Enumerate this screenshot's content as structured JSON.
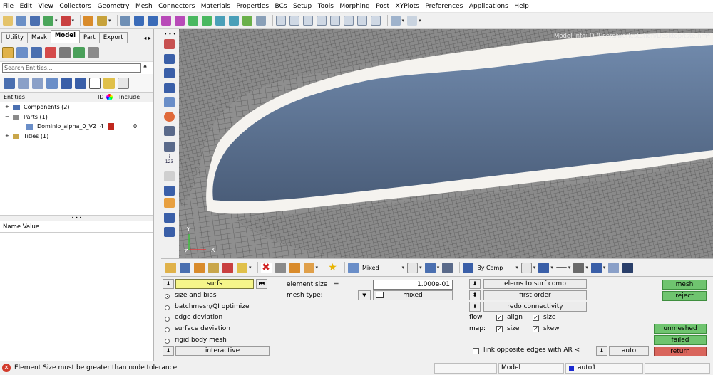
{
  "menu": [
    "File",
    "Edit",
    "View",
    "Collectors",
    "Geometry",
    "Mesh",
    "Connectors",
    "Materials",
    "Properties",
    "BCs",
    "Setup",
    "Tools",
    "Morphing",
    "Post",
    "XYPlots",
    "Preferences",
    "Applications",
    "Help"
  ],
  "left_panel": {
    "tabs": [
      "Utility",
      "Mask",
      "Model",
      "Part",
      "Export"
    ],
    "active_tab": "Model",
    "tab_nav": "◂ ▸",
    "search_placeholder": "Search Entities...",
    "columns": {
      "entities": "Entities",
      "id": "ID",
      "include": "Include"
    },
    "tree": [
      {
        "label": "Components (2)",
        "id": "",
        "include": ""
      },
      {
        "label": "Parts (1)",
        "id": "",
        "include": ""
      },
      {
        "label": "Dominio_alpha_0_V2",
        "id": "4",
        "include": "0"
      },
      {
        "label": "Titles (1)",
        "id": "",
        "include": ""
      }
    ],
    "name_value_header": "Name Value"
  },
  "viewport": {
    "model_info": "Model Info: D:/Users/work.station/Desktop/tste.hm*",
    "axis_x": "X",
    "axis_y": "Y",
    "axis_z": "Z",
    "colors": {
      "mesh_bg": "#8f8f8f",
      "airfoil_top": "#7089ab",
      "airfoil_bottom": "#4a5d79",
      "gap": "#f5f3ef"
    }
  },
  "bottom_toolbar": {
    "mixed_label": "Mixed",
    "bycomp_label": "By Comp"
  },
  "panel": {
    "surfs_label": "surfs",
    "element_size_label": "element size",
    "element_size_eq": "=",
    "element_size_value": "1.000e-01",
    "mesh_type_label": "mesh type:",
    "mesh_type_value": "mixed",
    "options": [
      {
        "label": "size and bias",
        "selected": true
      },
      {
        "label": "batchmesh/QI optimize",
        "selected": false
      },
      {
        "label": "edge deviation",
        "selected": false
      },
      {
        "label": "surface deviation",
        "selected": false
      },
      {
        "label": "rigid body mesh",
        "selected": false
      }
    ],
    "interactive_label": "interactive",
    "elems_to_surf_comp": "elems to surf comp",
    "first_order": "first order",
    "redo_connectivity": "redo connectivity",
    "flow_label": "flow:",
    "map_label": "map:",
    "align_label": "align",
    "size_label": "size",
    "skew_label": "skew",
    "link_label": "link opposite edges with AR <",
    "auto_label": "auto",
    "mesh_btn": "mesh",
    "reject_btn": "reject",
    "unmeshed_btn": "unmeshed",
    "failed_btn": "failed",
    "return_btn": "return",
    "colors": {
      "green": "#6fc46f",
      "red": "#d9655c",
      "yellow": "#f5f58a"
    }
  },
  "status": {
    "message": "Element Size must be greater than node tolerance.",
    "model": "Model",
    "collector": "auto1"
  }
}
